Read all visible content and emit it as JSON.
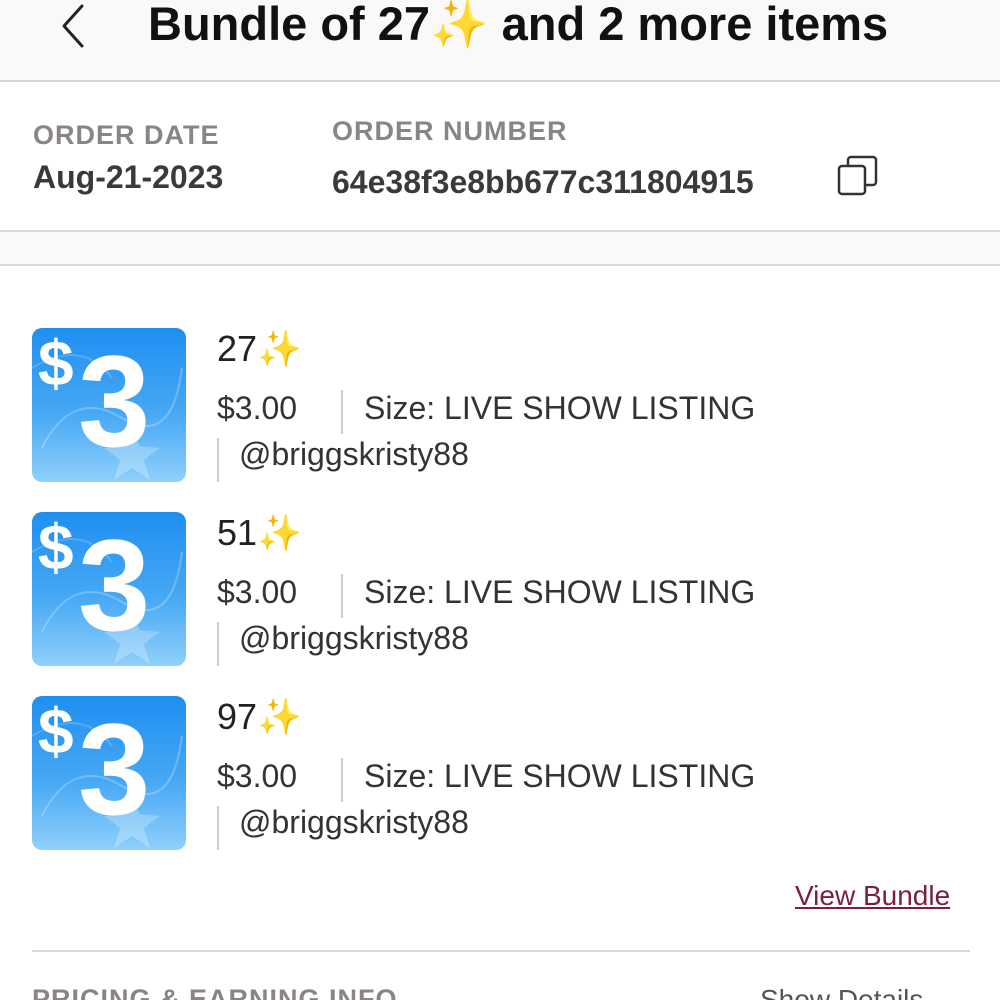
{
  "header": {
    "back_icon": "chevron-left-icon",
    "title": "Bundle of 27✨ and 2 more items"
  },
  "order": {
    "date_label": "ORDER DATE",
    "date_value": "Aug-21-2023",
    "number_label": "ORDER NUMBER",
    "number_value": "64e38f3e8bb677c311804915",
    "copy_icon": "copy-icon"
  },
  "items": [
    {
      "thumb_dollar": "$",
      "thumb_num": "3",
      "title": "27✨",
      "price": "$3.00",
      "size": "Size: LIVE SHOW LISTING",
      "seller": "@briggskristy88"
    },
    {
      "thumb_dollar": "$",
      "thumb_num": "3",
      "title": "51✨",
      "price": "$3.00",
      "size": "Size: LIVE SHOW LISTING",
      "seller": "@briggskristy88"
    },
    {
      "thumb_dollar": "$",
      "thumb_num": "3",
      "title": "97✨",
      "price": "$3.00",
      "size": "Size: LIVE SHOW LISTING",
      "seller": "@briggskristy88"
    }
  ],
  "bundle": {
    "view_label": "View Bundle"
  },
  "pricing": {
    "label": "PRICING & EARNING INFO",
    "show_details": "Show Details"
  },
  "colors": {
    "accent_link": "#7a1f3d",
    "label_gray": "#8a8585",
    "thumb_blue": "#1f8ff0"
  }
}
